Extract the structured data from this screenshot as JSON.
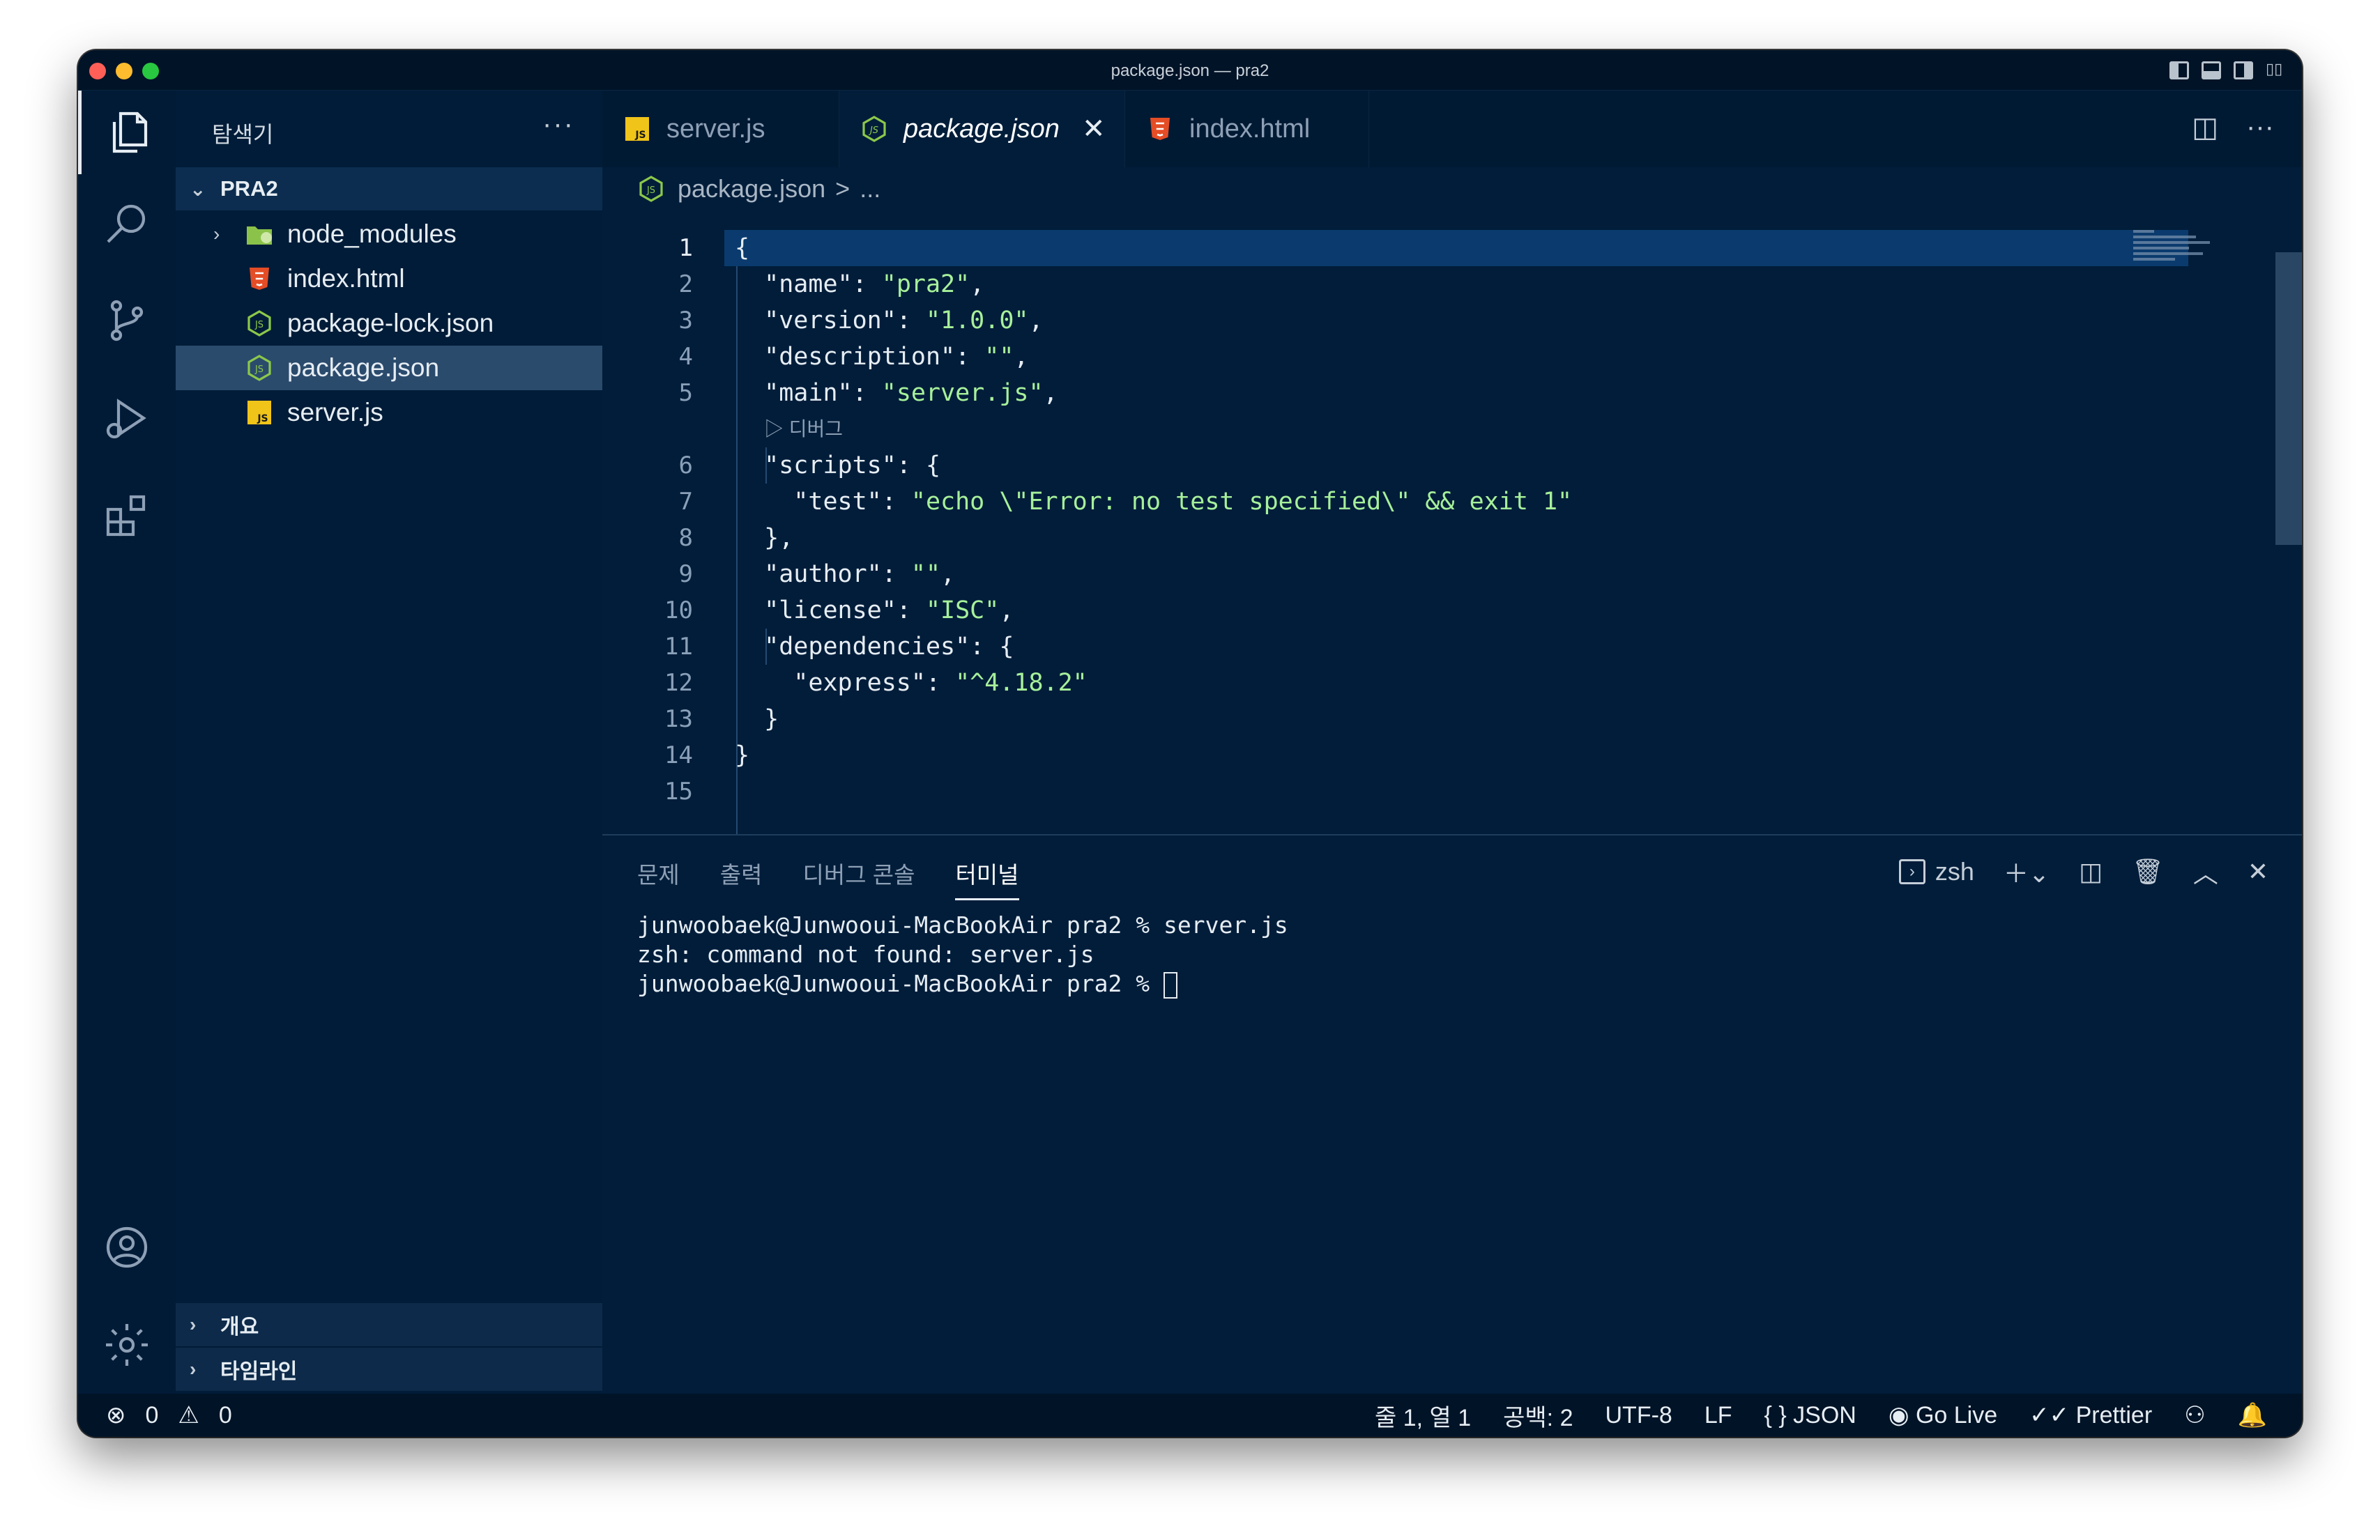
{
  "window": {
    "title": "package.json — pra2"
  },
  "sidebar": {
    "title": "탐색기",
    "more": "···",
    "root": "PRA2",
    "items": [
      {
        "label": "node_modules",
        "type": "folder"
      },
      {
        "label": "index.html",
        "type": "html"
      },
      {
        "label": "package-lock.json",
        "type": "json"
      },
      {
        "label": "package.json",
        "type": "json",
        "selected": true
      },
      {
        "label": "server.js",
        "type": "js"
      }
    ],
    "sections": [
      "개요",
      "타임라인"
    ]
  },
  "tabs": [
    {
      "label": "server.js",
      "type": "js"
    },
    {
      "label": "package.json",
      "type": "json",
      "active": true
    },
    {
      "label": "index.html",
      "type": "html"
    }
  ],
  "breadcrumb": {
    "file": "package.json",
    "sep": ">",
    "rest": "..."
  },
  "editor": {
    "line_numbers": [
      "1",
      "2",
      "3",
      "4",
      "5",
      "6",
      "7",
      "8",
      "9",
      "10",
      "11",
      "12",
      "13",
      "14",
      "15"
    ],
    "codelens": "▷ 디버그",
    "lines": [
      "{",
      "  \"name\": \"pra2\",",
      "  \"version\": \"1.0.0\",",
      "  \"description\": \"\",",
      "  \"main\": \"server.js\",",
      "  \"scripts\": {",
      "    \"test\": \"echo \\\"Error: no test specified\\\" && exit 1\"",
      "  },",
      "  \"author\": \"\",",
      "  \"license\": \"ISC\",",
      "  \"dependencies\": {",
      "    \"express\": \"^4.18.2\"",
      "  }",
      "}",
      ""
    ]
  },
  "panel": {
    "tabs": [
      "문제",
      "출력",
      "디버그 콘솔",
      "터미널"
    ],
    "active_tab": "터미널",
    "shell": "zsh",
    "terminal": [
      "junwoobaek@Junwooui-MacBookAir pra2 % server.js",
      "zsh: command not found: server.js",
      "junwoobaek@Junwooui-MacBookAir pra2 % "
    ]
  },
  "status": {
    "errors": "0",
    "warnings": "0",
    "position": "줄 1, 열 1",
    "spaces": "공백: 2",
    "encoding": "UTF-8",
    "eol": "LF",
    "language": "JSON",
    "golive": "Go Live",
    "prettier": "Prettier"
  },
  "colors": {
    "background": "#011d3a",
    "string": "#a7f09a",
    "current_line": "#0b3b6e",
    "selection": "#2b4b6d"
  }
}
